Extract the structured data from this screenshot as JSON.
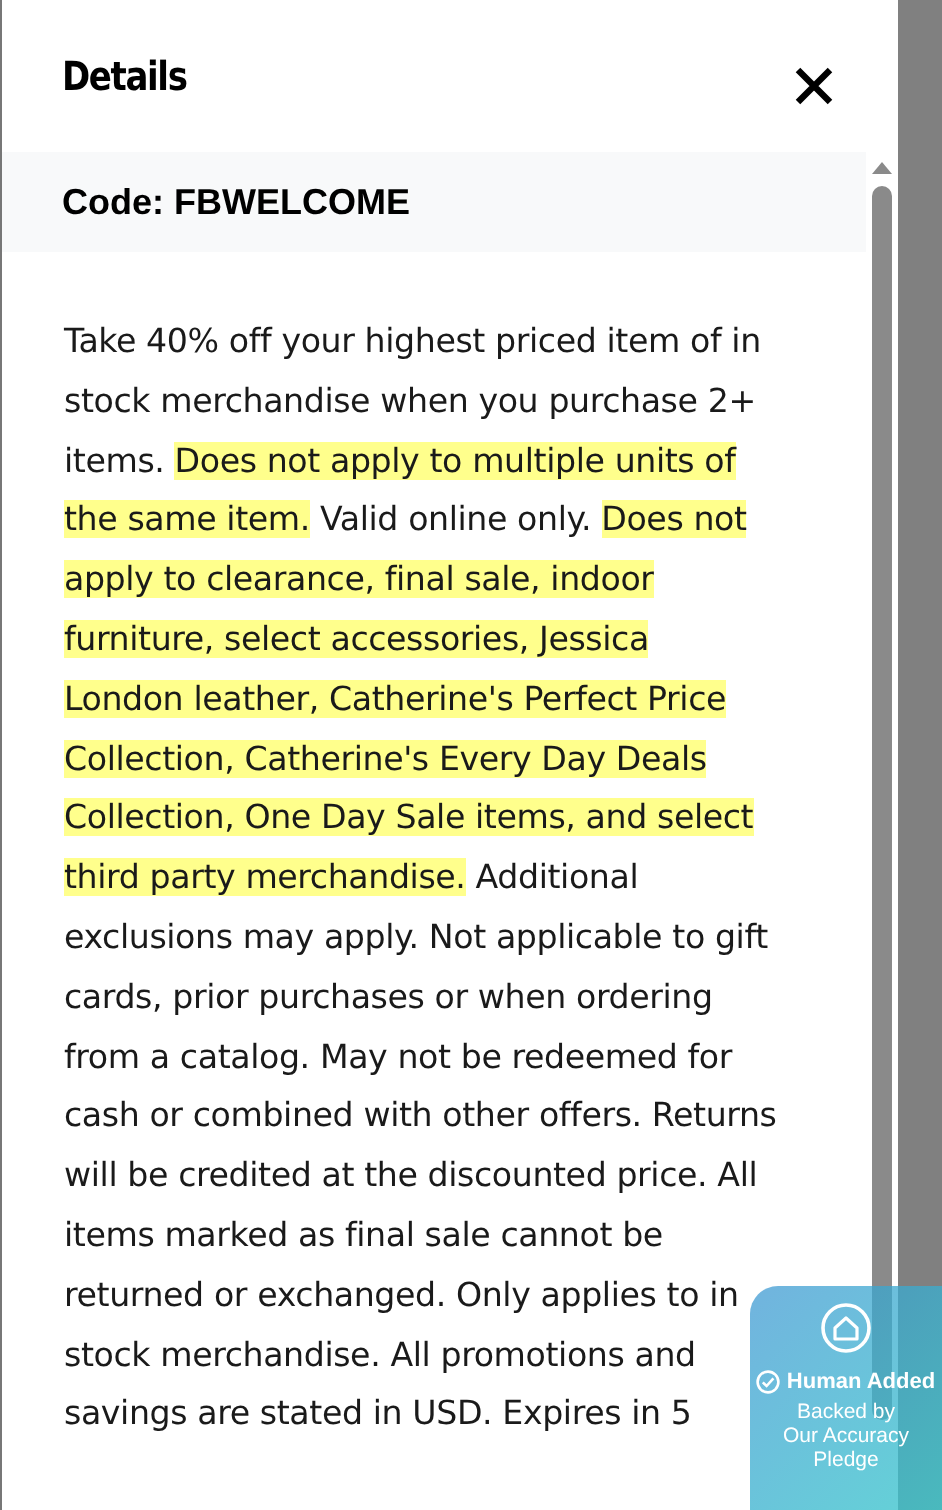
{
  "panel": {
    "title": "Details",
    "code": "Code: FBWELCOME",
    "description": [
      {
        "text": "Take 40% off your highest priced item of in stock merchandise when you purchase 2+ items. ",
        "highlighted": false
      },
      {
        "text": "Does not apply to multiple units of the same item.",
        "highlighted": true
      },
      {
        "text": " Valid online only. ",
        "highlighted": false
      },
      {
        "text": "Does not apply to clearance, final sale, indoor furniture, select accessories, Jessica London leather, Catherine's Perfect Price Collection, Catherine's Every Day Deals Collection, One Day Sale items, and select third party merchandise.",
        "highlighted": true
      },
      {
        "text": " Additional exclusions may apply. Not applicable to gift cards, prior purchases or when ordering from a catalog. May not be redeemed for cash or combined with other offers. Returns will be credited at the discounted price. All items marked as final sale cannot be returned or exchanged. Only applies to in stock merchandise. All promotions and savings are stated in USD. Expires in 5",
        "highlighted": false
      }
    ]
  },
  "badge": {
    "title": "Human Added",
    "subtitle": "Backed by",
    "pledge": "Our Accuracy Pledge"
  }
}
